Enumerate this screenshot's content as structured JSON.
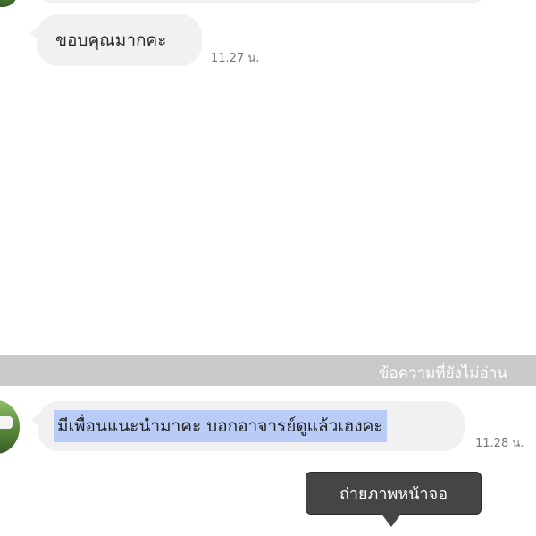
{
  "chat": {
    "messages": [
      {
        "text": "ขอบคุณมากคะ",
        "time": "11.27 น."
      },
      {
        "text": "มีเพื่อนแนะนำมาคะ บอกอาจารย์ดูแล้วเฮงคะ",
        "time": "11.28 น."
      }
    ],
    "unread_divider": "ข้อความที่ยังไม่อ่าน"
  },
  "tooltip": {
    "label": "ถ่ายภาพหน้าจอ"
  },
  "colors": {
    "bubble": "#f1f1f2",
    "divider": "#c9c9c9",
    "selection": "#b8ccf6",
    "tooltip": "#454546"
  },
  "icons": {
    "avatar_top": "avatar",
    "avatar_bottom": "avatar"
  }
}
